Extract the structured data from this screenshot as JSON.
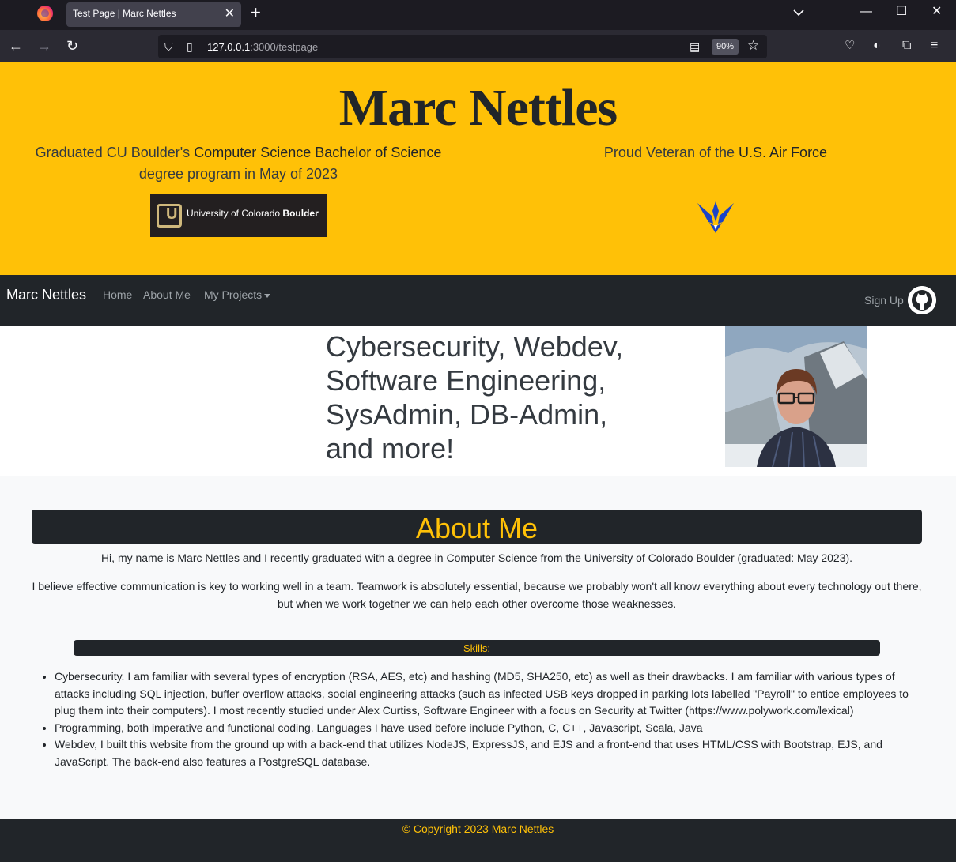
{
  "browser": {
    "tab_title": "Test Page | Marc Nettles",
    "url_host": "127.0.0.1",
    "url_rest": ":3000/testpage",
    "zoom": "90%"
  },
  "hero": {
    "title": "Marc Nettles",
    "left_text_pre": "Graduated CU Boulder's ",
    "left_text_hl": "Computer Science Bachelor of Science",
    "left_text_post": " degree program in May of 2023",
    "right_text_pre": "Proud Veteran of the ",
    "right_text_hl": "U.S. Air Force",
    "cu_logo_text": "University of Colorado",
    "cu_logo_bold": "Boulder"
  },
  "nav": {
    "brand": "Marc Nettles",
    "home": "Home",
    "about": "About Me",
    "projects": "My Projects",
    "signup": "Sign Up"
  },
  "intro": {
    "text": "Cybersecurity, Webdev, Software Engineering, SysAdmin, DB-Admin, and more!"
  },
  "about": {
    "title": "About Me",
    "p1": "Hi, my name is Marc Nettles and I recently graduated with a degree in Computer Science from the University of Colorado Boulder (graduated: May 2023).",
    "p2": "I believe effective communication is key to working well in a team. Teamwork is absolutely essential, because we probably won't all know everything about every technology out there, but when we work together we can help each other overcome those weaknesses.",
    "skills_title": "Skills:",
    "skills": [
      "Cybersecurity. I am familiar with several types of encryption (RSA, AES, etc) and hashing (MD5, SHA250, etc) as well as their drawbacks. I am familiar with various types of attacks including SQL injection, buffer overflow attacks, social engineering attacks (such as infected USB keys dropped in parking lots labelled \"Payroll\" to entice employees to plug them into their computers). I most recently studied under Alex Curtiss, Software Engineer with a focus on Security at Twitter (https://www.polywork.com/lexical)",
      "Programming, both imperative and functional coding. Languages I have used before include Python, C, C++, Javascript, Scala, Java",
      "Webdev, I built this website from the ground up with a back-end that utilizes NodeJS, ExpressJS, and EJS and a front-end that uses HTML/CSS with Bootstrap, EJS, and JavaScript. The back-end also features a PostgreSQL database."
    ]
  },
  "footer": {
    "copyright": "© Copyright 2023 Marc Nettles"
  },
  "colors": {
    "accent": "#ffc107",
    "dark": "#212529",
    "light": "#f8f9fa",
    "air_force_blue": "#1a43c8"
  }
}
